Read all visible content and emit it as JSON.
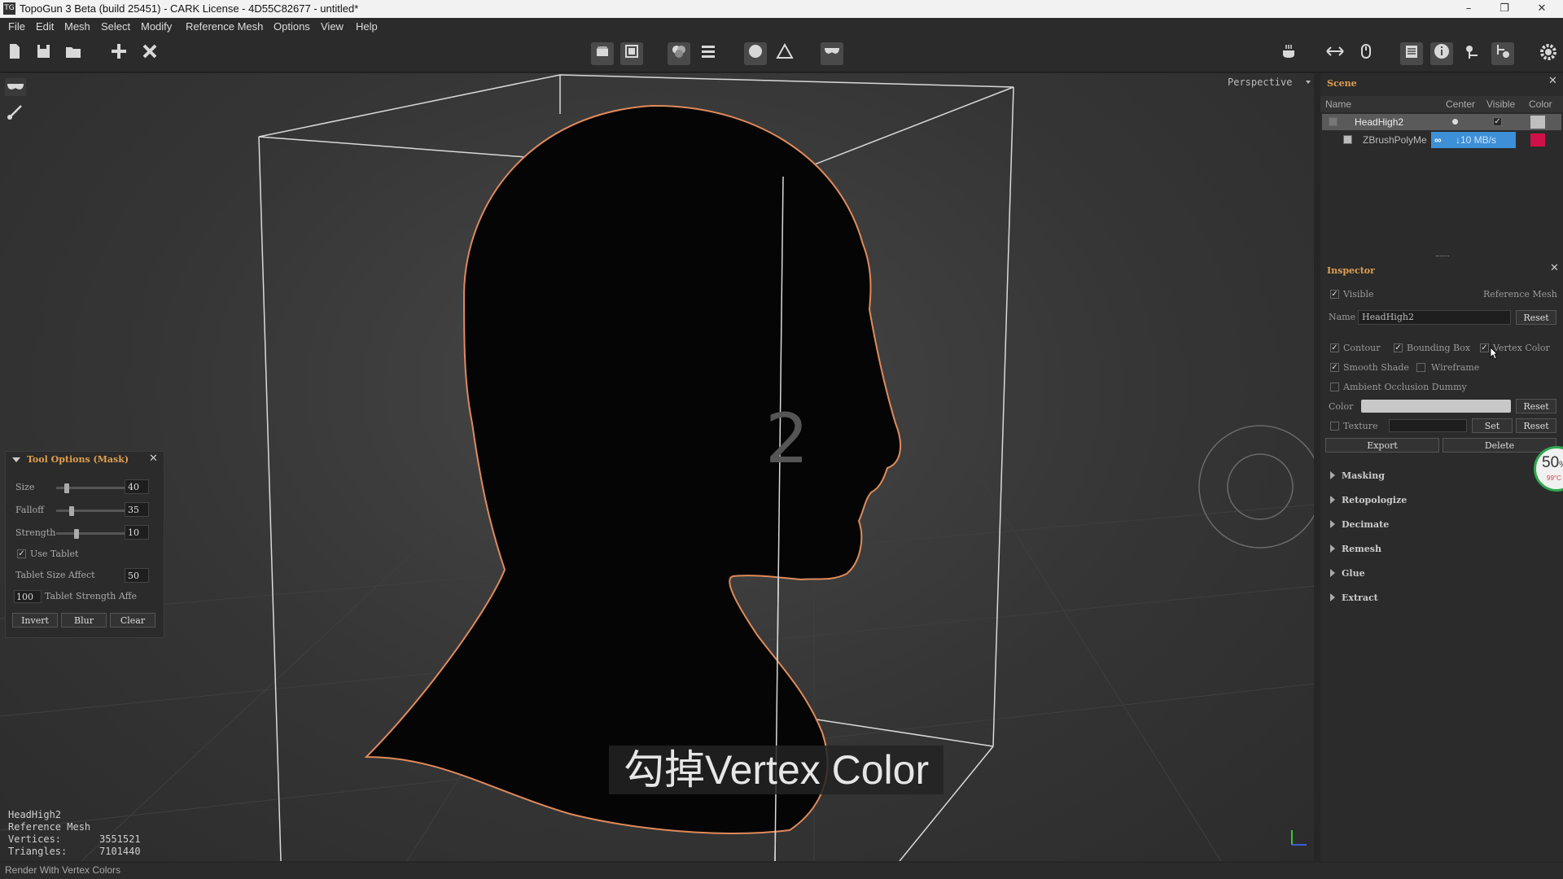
{
  "window": {
    "title": "TopoGun 3 Beta (build 25451) - CARK License - 4D55C82677 - untitled*",
    "app_icon": "TG",
    "minimize": "–",
    "restore": "❐",
    "close": "✕"
  },
  "menu": [
    "File",
    "Edit",
    "Mesh",
    "Select",
    "Modify",
    "Reference Mesh",
    "Options",
    "View",
    "Help"
  ],
  "toolbar_icons": [
    "new-file-icon",
    "save-icon",
    "open-icon",
    "add-icon",
    "close-icon",
    "mesh-view-icon",
    "wire-view-icon",
    "paint-icon",
    "layers-icon",
    "sphere-icon",
    "triangle-icon",
    "mask-icon",
    "coffee-icon",
    "arrows-horizontal-icon",
    "mouse-icon",
    "list-icon",
    "info-icon",
    "settings-nodes-icon",
    "tool-icon",
    "gear-icon"
  ],
  "viewport": {
    "projection": "Perspective",
    "center_number": "2",
    "subtitle": "勾掉Vertex Color",
    "info": {
      "name": "HeadHigh2",
      "type": "Reference Mesh",
      "vertices_label": "Vertices:",
      "vertices": "3551521",
      "triangles_label": "Triangles:",
      "triangles": "7101440"
    }
  },
  "tool_options": {
    "title": "Tool Options (Mask)",
    "size_label": "Size",
    "size": "40",
    "size_fraction": 0.15,
    "falloff_label": "Falloff",
    "falloff": "35",
    "falloff_fraction": 0.22,
    "strength_label": "Strength",
    "strength": "10",
    "strength_fraction": 0.3,
    "use_tablet_label": "Use Tablet",
    "tablet_size_label": "Tablet Size Affect",
    "tablet_size": "50",
    "tablet_strength_value": "100",
    "tablet_strength_label": "Tablet Strength Affe",
    "invert": "Invert",
    "blur": "Blur",
    "clear": "Clear"
  },
  "scene": {
    "title": "Scene",
    "columns": [
      "Name",
      "Center",
      "Visible",
      "Color"
    ],
    "rows": [
      {
        "name": "HeadHigh2",
        "color": "#bfbfbf"
      },
      {
        "name": "ZBrushPolyMe",
        "color": "#d0104a"
      }
    ],
    "network_speed": "↓10 MB/s"
  },
  "inspector": {
    "title": "Inspector",
    "visible_label": "Visible",
    "type": "Reference Mesh",
    "name_label": "Name",
    "name_value": "HeadHigh2",
    "reset": "Reset",
    "contour": "Contour",
    "bounding_box": "Bounding Box",
    "vertex_color": "Vertex Color",
    "smooth_shade": "Smooth Shade",
    "wireframe": "Wireframe",
    "ambient_occlusion": "Ambient Occlusion Dummy",
    "color_label": "Color",
    "texture_label": "Texture",
    "set": "Set",
    "export": "Export",
    "delete": "Delete",
    "sections": [
      "Masking",
      "Retopologize",
      "Decimate",
      "Remesh",
      "Glue",
      "Extract"
    ]
  },
  "cpu_widget": {
    "percent": "50",
    "unit": "%",
    "temp": "99°C"
  },
  "status": "Render With Vertex Colors"
}
